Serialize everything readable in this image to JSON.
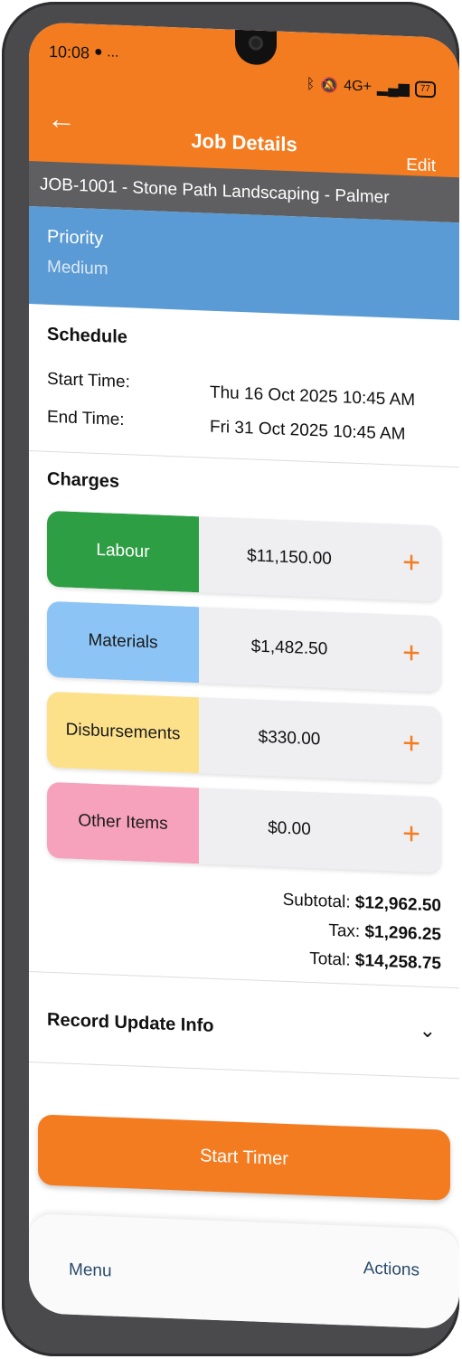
{
  "status_bar": {
    "time": "10:08",
    "extra": "● ...",
    "network": "4G+",
    "battery": "77"
  },
  "appbar": {
    "title": "Job Details",
    "back_icon": "arrow-left-icon",
    "edit_label": "Edit"
  },
  "job": {
    "header": "JOB-1001 - Stone Path Landscaping - Palmer"
  },
  "priority": {
    "label": "Priority",
    "value": "Medium"
  },
  "schedule": {
    "title": "Schedule",
    "start_label": "Start Time:",
    "start_value": "Thu 16 Oct 2025 10:45 AM",
    "end_label": "End Time:",
    "end_value": "Fri 31 Oct 2025 10:45 AM"
  },
  "charges": {
    "title": "Charges",
    "items": [
      {
        "label": "Labour",
        "amount": "$11,150.00",
        "color": "#2e9e44",
        "text_color": "#ffffff"
      },
      {
        "label": "Materials",
        "amount": "$1,482.50",
        "color": "#8cc4f5",
        "text_color": "#1a1a1a"
      },
      {
        "label": "Disbursements",
        "amount": "$330.00",
        "color": "#fde18a",
        "text_color": "#1a1a1a"
      },
      {
        "label": "Other Items",
        "amount": "$0.00",
        "color": "#f7a2bd",
        "text_color": "#1a1a1a"
      }
    ],
    "plus_symbol": "+"
  },
  "totals": {
    "subtotal_label": "Subtotal:",
    "subtotal_value": "$12,962.50",
    "tax_label": "Tax:",
    "tax_value": "$1,296.25",
    "total_label": "Total:",
    "total_value": "$14,258.75"
  },
  "record": {
    "label": "Record Update Info",
    "chevron_icon": "chevron-down-icon"
  },
  "actions": {
    "start_timer": "Start Timer",
    "menu": "Menu",
    "actions": "Actions"
  },
  "colors": {
    "accent": "#f47c20",
    "priority_bg": "#5b9bd5",
    "jobbar_bg": "#5f5f61"
  }
}
